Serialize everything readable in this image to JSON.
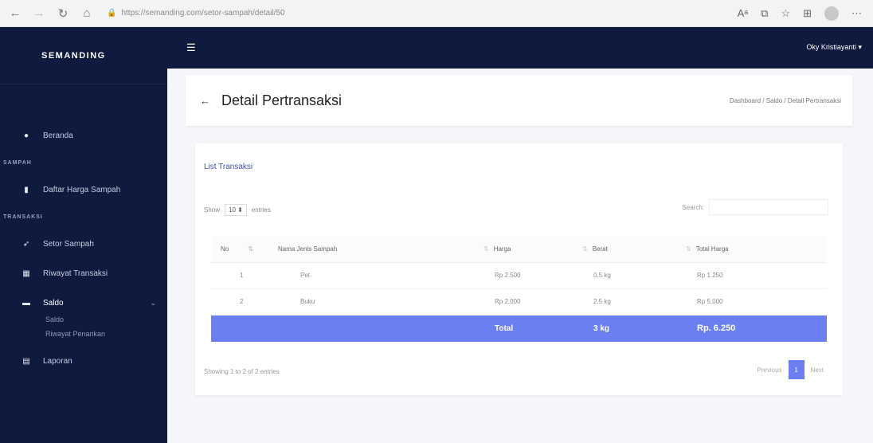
{
  "browser": {
    "url": "https://semanding.com/setor-sampah/detail/50",
    "icons": [
      "back-icon",
      "forward-icon",
      "refresh-icon",
      "home-icon",
      "read-aloud-icon",
      "collections-icon",
      "favorites-icon",
      "profile-icon",
      "more-icon"
    ]
  },
  "app": {
    "brand": "SEMANDING"
  },
  "topbar": {
    "user": "Oky Kristiayanti"
  },
  "sidebar": {
    "beranda": "Beranda",
    "section_sampah": "SAMPAH",
    "daftar_harga": "Daftar Harga Sampah",
    "section_transaksi": "TRANSAKSI",
    "setor_sampah": "Setor Sampah",
    "riwayat_transaksi": "Riwayat Transaksi",
    "saldo": "Saldo",
    "saldo_sub": [
      "Saldo",
      "Riwayat Penarikan"
    ],
    "laporan": "Laporan"
  },
  "header": {
    "title": "Detail Pertransaksi",
    "breadcrumb": "Dashboard / Saldo / Detail Pertransaksi"
  },
  "card": {
    "title": "List Transaksi",
    "show_label": "Show",
    "entries_value": "10",
    "entries_label": "entries",
    "search_label": "Search:",
    "search_placeholder": "",
    "table": {
      "headers": [
        "No",
        "Nama Jenis Sampah",
        "Harga",
        "Berat",
        "Total Harga"
      ],
      "rows": [
        [
          "1",
          "Pet",
          "Rp 2.500",
          "0.5 kg",
          "Rp 1.250"
        ],
        [
          "2",
          "Buku",
          "Rp 2.000",
          "2.5 kg",
          "Rp 5.000"
        ]
      ],
      "total": {
        "label": "Total",
        "berat": "3 kg",
        "harga": "Rp. 6.250"
      }
    },
    "info": "Showing 1 to 2 of 2 entries",
    "pagination": {
      "previous": "Previous",
      "page": "1",
      "next": "Next"
    }
  },
  "colors": {
    "sidebar": "#0f1a3f",
    "accent": "#6b7ff0",
    "link": "#3f51b5"
  }
}
